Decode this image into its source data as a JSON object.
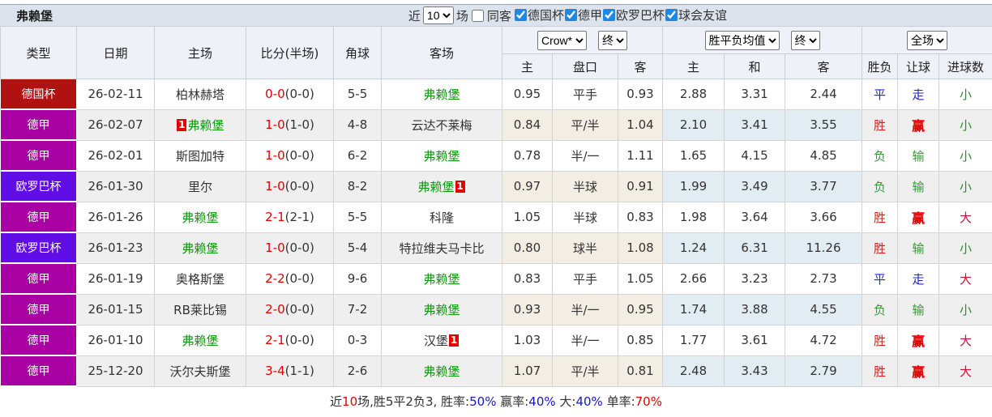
{
  "title": "弗赖堡",
  "toolbar": {
    "recent_label": "近",
    "matches_count": "10",
    "matches_label": "场",
    "same_away_label": "同客",
    "same_away_checked": false,
    "filters": [
      {
        "label": "德国杯",
        "checked": true
      },
      {
        "label": "德甲",
        "checked": true
      },
      {
        "label": "欧罗巴杯",
        "checked": true
      },
      {
        "label": "球会友谊",
        "checked": true
      }
    ]
  },
  "header": {
    "left_columns": [
      "类型",
      "日期",
      "主场",
      "比分(半场)",
      "角球",
      "客场"
    ],
    "odds_selects": {
      "provider": "Crow*",
      "provider_final": "终",
      "avg": "胜平负均值",
      "avg_final": "终",
      "scope": "全场"
    },
    "odds_columns": [
      "主",
      "盘口",
      "客"
    ],
    "avg_columns": [
      "主",
      "和",
      "客"
    ],
    "result_columns": [
      "胜负",
      "让球",
      "进球数"
    ]
  },
  "colors": {
    "leagues": {
      "德国杯": "#b01212",
      "德甲": "#a800a3",
      "欧罗巴杯": "#610de8"
    },
    "win_red": "#d42020",
    "bold_red": "#e00000",
    "loss_green": "#2f9e2f",
    "draw_blue": "#2323c8",
    "big_red": "#cc1433",
    "small_green": "#2e8b2e",
    "freiburg_green": "#0a9a0a",
    "score_red": "#e00000"
  },
  "rows": [
    {
      "league": "德国杯",
      "date": "26-02-11",
      "home": {
        "name": "柏林赫塔",
        "fb": false,
        "badge": null
      },
      "score_full": "0-0",
      "score_half": "(0-0)",
      "corner": "5-5",
      "away": {
        "name": "弗赖堡",
        "fb": true,
        "badge": null
      },
      "odds": [
        "0.95",
        "平手",
        "0.93"
      ],
      "avg": [
        "2.88",
        "3.31",
        "2.44"
      ],
      "results": [
        {
          "t": "平",
          "c": "#2323c8"
        },
        {
          "t": "走",
          "c": "#2323c8"
        },
        {
          "t": "小",
          "c": "#2e8b2e"
        }
      ]
    },
    {
      "league": "德甲",
      "date": "26-02-07",
      "home": {
        "name": "弗赖堡",
        "fb": true,
        "badge": {
          "text": "1",
          "pos": "before"
        }
      },
      "score_full": "1-0",
      "score_half": "(1-0)",
      "corner": "4-8",
      "away": {
        "name": "云达不莱梅",
        "fb": false,
        "badge": null
      },
      "odds": [
        "0.84",
        "平/半",
        "1.04"
      ],
      "avg": [
        "2.10",
        "3.41",
        "3.55"
      ],
      "results": [
        {
          "t": "胜",
          "c": "#d42020"
        },
        {
          "t": "赢",
          "c": "#e00000",
          "b": true
        },
        {
          "t": "小",
          "c": "#2e8b2e"
        }
      ]
    },
    {
      "league": "德甲",
      "date": "26-02-01",
      "home": {
        "name": "斯图加特",
        "fb": false,
        "badge": null
      },
      "score_full": "1-0",
      "score_half": "(0-0)",
      "corner": "6-2",
      "away": {
        "name": "弗赖堡",
        "fb": true,
        "badge": null
      },
      "odds": [
        "0.78",
        "半/一",
        "1.11"
      ],
      "avg": [
        "1.65",
        "4.15",
        "4.85"
      ],
      "results": [
        {
          "t": "负",
          "c": "#2f9e2f"
        },
        {
          "t": "输",
          "c": "#2f9e2f"
        },
        {
          "t": "小",
          "c": "#2e8b2e"
        }
      ]
    },
    {
      "league": "欧罗巴杯",
      "date": "26-01-30",
      "home": {
        "name": "里尔",
        "fb": false,
        "badge": null
      },
      "score_full": "1-0",
      "score_half": "(0-0)",
      "corner": "8-2",
      "away": {
        "name": "弗赖堡",
        "fb": true,
        "badge": {
          "text": "1",
          "pos": "after"
        }
      },
      "odds": [
        "0.97",
        "半球",
        "0.91"
      ],
      "avg": [
        "1.99",
        "3.49",
        "3.77"
      ],
      "results": [
        {
          "t": "负",
          "c": "#2f9e2f"
        },
        {
          "t": "输",
          "c": "#2f9e2f"
        },
        {
          "t": "小",
          "c": "#2e8b2e"
        }
      ]
    },
    {
      "league": "德甲",
      "date": "26-01-26",
      "home": {
        "name": "弗赖堡",
        "fb": true,
        "badge": null
      },
      "score_full": "2-1",
      "score_half": "(2-1)",
      "corner": "5-5",
      "away": {
        "name": "科隆",
        "fb": false,
        "badge": null
      },
      "odds": [
        "1.05",
        "半球",
        "0.83"
      ],
      "avg": [
        "1.98",
        "3.64",
        "3.66"
      ],
      "results": [
        {
          "t": "胜",
          "c": "#d42020"
        },
        {
          "t": "赢",
          "c": "#e00000",
          "b": true
        },
        {
          "t": "大",
          "c": "#cc1433"
        }
      ]
    },
    {
      "league": "欧罗巴杯",
      "date": "26-01-23",
      "home": {
        "name": "弗赖堡",
        "fb": true,
        "badge": null
      },
      "score_full": "1-0",
      "score_half": "(0-0)",
      "corner": "5-4",
      "away": {
        "name": "特拉维夫马卡比",
        "fb": false,
        "badge": null
      },
      "odds": [
        "0.80",
        "球半",
        "1.08"
      ],
      "avg": [
        "1.24",
        "6.31",
        "11.26"
      ],
      "results": [
        {
          "t": "胜",
          "c": "#d42020"
        },
        {
          "t": "输",
          "c": "#2f9e2f"
        },
        {
          "t": "小",
          "c": "#2e8b2e"
        }
      ]
    },
    {
      "league": "德甲",
      "date": "26-01-19",
      "home": {
        "name": "奥格斯堡",
        "fb": false,
        "badge": null
      },
      "score_full": "2-2",
      "score_half": "(0-0)",
      "corner": "9-6",
      "away": {
        "name": "弗赖堡",
        "fb": true,
        "badge": null
      },
      "odds": [
        "0.83",
        "平手",
        "1.05"
      ],
      "avg": [
        "2.66",
        "3.23",
        "2.73"
      ],
      "results": [
        {
          "t": "平",
          "c": "#2323c8"
        },
        {
          "t": "走",
          "c": "#2323c8"
        },
        {
          "t": "大",
          "c": "#cc1433"
        }
      ]
    },
    {
      "league": "德甲",
      "date": "26-01-15",
      "home": {
        "name": "RB莱比锡",
        "fb": false,
        "badge": null
      },
      "score_full": "2-0",
      "score_half": "(0-0)",
      "corner": "7-2",
      "away": {
        "name": "弗赖堡",
        "fb": true,
        "badge": null
      },
      "odds": [
        "0.93",
        "半/一",
        "0.95"
      ],
      "avg": [
        "1.74",
        "3.88",
        "4.55"
      ],
      "results": [
        {
          "t": "负",
          "c": "#2f9e2f"
        },
        {
          "t": "输",
          "c": "#2f9e2f"
        },
        {
          "t": "小",
          "c": "#2e8b2e"
        }
      ]
    },
    {
      "league": "德甲",
      "date": "26-01-10",
      "home": {
        "name": "弗赖堡",
        "fb": true,
        "badge": null
      },
      "score_full": "2-1",
      "score_half": "(0-0)",
      "corner": "0-3",
      "away": {
        "name": "汉堡",
        "fb": false,
        "badge": {
          "text": "1",
          "pos": "after"
        }
      },
      "odds": [
        "1.03",
        "半/一",
        "0.85"
      ],
      "avg": [
        "1.77",
        "3.61",
        "4.72"
      ],
      "results": [
        {
          "t": "胜",
          "c": "#d42020"
        },
        {
          "t": "赢",
          "c": "#e00000",
          "b": true
        },
        {
          "t": "大",
          "c": "#cc1433"
        }
      ]
    },
    {
      "league": "德甲",
      "date": "25-12-20",
      "home": {
        "name": "沃尔夫斯堡",
        "fb": false,
        "badge": null
      },
      "score_full": "3-4",
      "score_half": "(1-1)",
      "corner": "2-6",
      "away": {
        "name": "弗赖堡",
        "fb": true,
        "badge": null
      },
      "odds": [
        "1.07",
        "平/半",
        "0.81"
      ],
      "avg": [
        "2.48",
        "3.43",
        "2.79"
      ],
      "results": [
        {
          "t": "胜",
          "c": "#d42020"
        },
        {
          "t": "赢",
          "c": "#e00000",
          "b": true
        },
        {
          "t": "大",
          "c": "#cc1433"
        }
      ]
    }
  ],
  "footer": {
    "segments": [
      {
        "text": "近",
        "color": "#333333"
      },
      {
        "text": "10",
        "color": "#e00000"
      },
      {
        "text": "场,胜5平2负3, 胜率:",
        "color": "#333333"
      },
      {
        "text": "50%",
        "color": "#1515cc"
      },
      {
        "text": " 赢率:",
        "color": "#333333"
      },
      {
        "text": "40%",
        "color": "#1515cc"
      },
      {
        "text": " 大:",
        "color": "#333333"
      },
      {
        "text": "40%",
        "color": "#1515cc"
      },
      {
        "text": " 单率:",
        "color": "#333333"
      },
      {
        "text": "70%",
        "color": "#e00000"
      }
    ]
  }
}
